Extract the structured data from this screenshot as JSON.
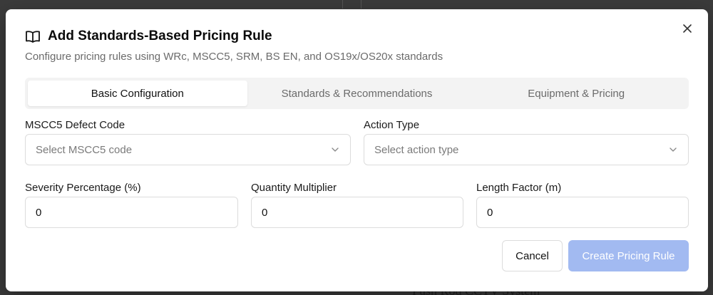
{
  "background": {
    "partial_text": "Push Rod CCTV System"
  },
  "modal": {
    "title": "Add Standards-Based Pricing Rule",
    "subtitle": "Configure pricing rules using WRc, MSCC5, SRM, BS EN, and OS19x/OS20x standards",
    "tabs": [
      {
        "label": "Basic Configuration",
        "active": true
      },
      {
        "label": "Standards & Recommendations",
        "active": false
      },
      {
        "label": "Equipment & Pricing",
        "active": false
      }
    ],
    "fields": {
      "mscc5_code": {
        "label": "MSCC5 Defect Code",
        "placeholder": "Select MSCC5 code"
      },
      "action_type": {
        "label": "Action Type",
        "placeholder": "Select action type"
      },
      "severity": {
        "label": "Severity Percentage (%)",
        "value": "0"
      },
      "quantity": {
        "label": "Quantity Multiplier",
        "value": "0"
      },
      "length": {
        "label": "Length Factor (m)",
        "value": "0"
      }
    },
    "buttons": {
      "cancel": "Cancel",
      "create": "Create Pricing Rule"
    }
  },
  "colors": {
    "accent_disabled": "#a2baf1",
    "overlay": "#3b3b3b"
  },
  "icons": {
    "title": "book-open-icon",
    "close": "close-icon",
    "select": "chevron-down-icon"
  }
}
